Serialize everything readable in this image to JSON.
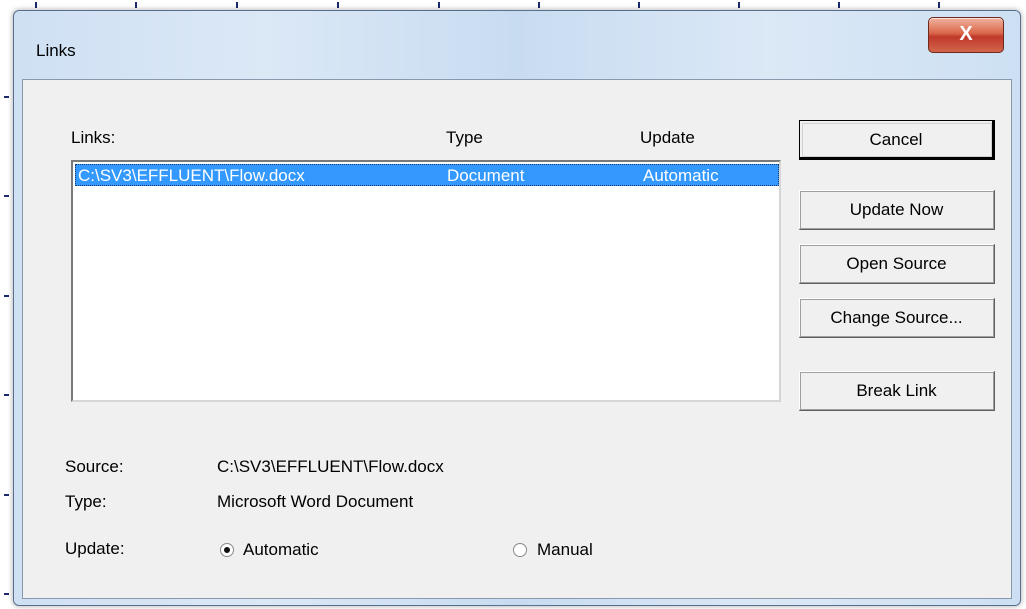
{
  "window": {
    "title": "Links",
    "close_glyph": "X"
  },
  "list": {
    "headers": {
      "links": "Links:",
      "type": "Type",
      "update": "Update"
    },
    "rows": [
      {
        "link": "C:\\SV3\\EFFLUENT\\Flow.docx",
        "type": "Document",
        "update": "Automatic",
        "selected": true
      }
    ]
  },
  "buttons": {
    "cancel": "Cancel",
    "update_now": "Update Now",
    "open_source": "Open Source",
    "change_source": "Change Source...",
    "break_link": "Break Link"
  },
  "details": {
    "source_label": "Source:",
    "source_value": "C:\\SV3\\EFFLUENT\\Flow.docx",
    "type_label": "Type:",
    "type_value": "Microsoft Word Document",
    "update_label": "Update:",
    "automatic_label": "Automatic",
    "manual_label": "Manual",
    "selected_update": "Automatic"
  },
  "colors": {
    "selection": "#3399ff",
    "close_button": "#c0392b",
    "dialog_bg": "#f0f0f0"
  },
  "icons": {
    "close": "close-icon",
    "radio": "radio-button"
  }
}
